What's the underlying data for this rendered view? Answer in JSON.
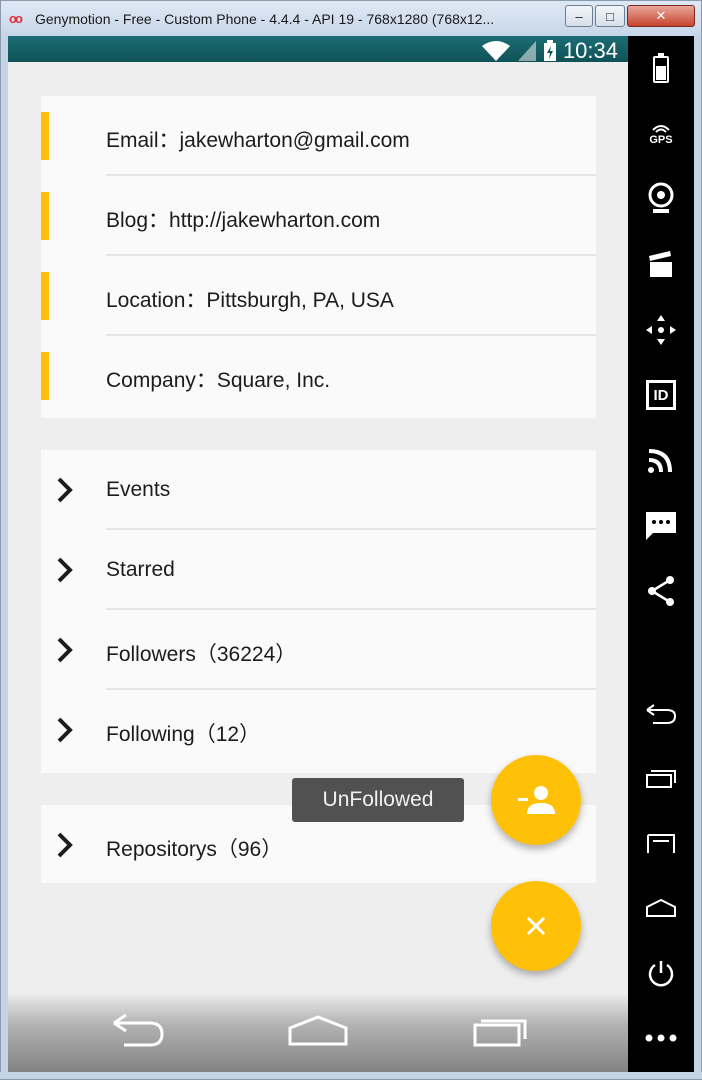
{
  "window": {
    "title": "Genymotion - Free - Custom Phone - 4.4.4 - API 19 - 768x1280 (768x12...",
    "app_icon": "oo",
    "minimize": "–",
    "maximize": "□",
    "close": "✕"
  },
  "statusbar": {
    "time": "10:34"
  },
  "info": {
    "rows": [
      {
        "label": "Email：jakewharton@gmail.com"
      },
      {
        "label": "Blog：http://jakewharton.com"
      },
      {
        "label": "Location：Pittsburgh, PA, USA"
      },
      {
        "label": "Company：Square, Inc."
      }
    ]
  },
  "links": {
    "rows": [
      {
        "label": "Events"
      },
      {
        "label": "Starred"
      },
      {
        "label": "Followers（36224）"
      },
      {
        "label": "Following（12）"
      }
    ]
  },
  "repos": {
    "label": "Repositorys（96）"
  },
  "toast": {
    "text": "UnFollowed"
  },
  "colors": {
    "accent": "#ffc107",
    "statusbar": "#0f5257",
    "card": "#fafafa",
    "background": "#eeeeee"
  },
  "icons": {
    "fab_follow": "person-remove-icon",
    "fab_close": "close-icon",
    "sidebar": [
      "battery-icon",
      "gps-icon",
      "webcam-icon",
      "screencast-icon",
      "dpad-icon",
      "id-icon",
      "cast-icon",
      "sms-icon",
      "share-icon",
      "back-icon",
      "recent-apps-icon",
      "menu-icon",
      "home-icon",
      "power-icon",
      "more-icon"
    ]
  },
  "sidebar": {
    "gps_label": "GPS",
    "id_label": "ID"
  }
}
